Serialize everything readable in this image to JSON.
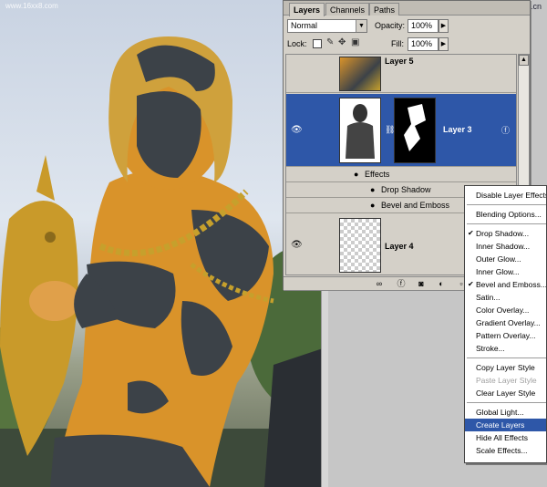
{
  "watermarks": {
    "left": "www.16xx8.com",
    "right": "www.pc-ts.cn"
  },
  "palette": {
    "tabs": [
      "Layers",
      "Channels",
      "Paths"
    ],
    "blend_mode": "Normal",
    "opacity_label": "Opacity:",
    "opacity_value": "100%",
    "lock_label": "Lock:",
    "fill_label": "Fill:",
    "fill_value": "100%",
    "layers": [
      {
        "name": "Layer 5",
        "visible": true,
        "selected": false
      },
      {
        "name": "Layer 3",
        "visible": true,
        "selected": true
      },
      {
        "name": "Layer 4",
        "visible": true,
        "selected": false
      }
    ],
    "effects_label": "Effects",
    "effects": [
      "Drop Shadow",
      "Bevel and Emboss"
    ],
    "icons": [
      "eye-icon",
      "link-icon",
      "fx-icon",
      "mask-icon",
      "new-layer-icon",
      "trash-icon",
      "adjustment-icon"
    ]
  },
  "context_menu": {
    "groups": [
      [
        {
          "label": "Disable Layer Effects",
          "checked": false,
          "disabled": false
        }
      ],
      [
        {
          "label": "Blending Options...",
          "checked": false,
          "disabled": false
        }
      ],
      [
        {
          "label": "Drop Shadow...",
          "checked": true,
          "disabled": false
        },
        {
          "label": "Inner Shadow...",
          "checked": false,
          "disabled": false
        },
        {
          "label": "Outer Glow...",
          "checked": false,
          "disabled": false
        },
        {
          "label": "Inner Glow...",
          "checked": false,
          "disabled": false
        },
        {
          "label": "Bevel and Emboss...",
          "checked": true,
          "disabled": false
        },
        {
          "label": "Satin...",
          "checked": false,
          "disabled": false
        },
        {
          "label": "Color Overlay...",
          "checked": false,
          "disabled": false
        },
        {
          "label": "Gradient Overlay...",
          "checked": false,
          "disabled": false
        },
        {
          "label": "Pattern Overlay...",
          "checked": false,
          "disabled": false
        },
        {
          "label": "Stroke...",
          "checked": false,
          "disabled": false
        }
      ],
      [
        {
          "label": "Copy Layer Style",
          "checked": false,
          "disabled": false
        },
        {
          "label": "Paste Layer Style",
          "checked": false,
          "disabled": true
        },
        {
          "label": "Clear Layer Style",
          "checked": false,
          "disabled": false
        }
      ],
      [
        {
          "label": "Global Light...",
          "checked": false,
          "disabled": false
        },
        {
          "label": "Create Layers",
          "checked": false,
          "disabled": false,
          "highlighted": true
        },
        {
          "label": "Hide All Effects",
          "checked": false,
          "disabled": false
        },
        {
          "label": "Scale Effects...",
          "checked": false,
          "disabled": false
        }
      ]
    ]
  },
  "colors": {
    "selection": "#2e57a8",
    "panel": "#d4d0c8",
    "statue_gold": "#d9932a",
    "statue_gray": "#3c4248"
  }
}
